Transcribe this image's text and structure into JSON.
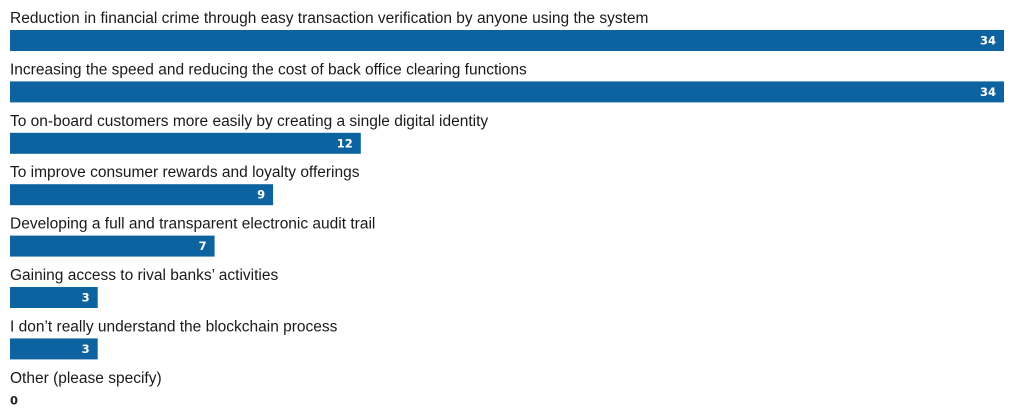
{
  "chart_data": {
    "type": "bar",
    "orientation": "horizontal",
    "categories": [
      "Reduction in financial crime through easy transaction verification by anyone using the system",
      "Increasing the speed and reducing the cost of back office clearing functions",
      "To on-board customers more easily by creating a single digital identity",
      "To improve consumer rewards and loyalty offerings",
      "Developing a full and transparent electronic audit trail",
      "Gaining access to rival banks’ activities",
      "I don’t really understand the blockchain process",
      "Other (please specify)"
    ],
    "values": [
      34,
      34,
      12,
      9,
      7,
      3,
      3,
      0
    ],
    "value_labels": [
      "34",
      "34",
      "12",
      "9",
      "7",
      "3",
      "3",
      "0"
    ],
    "xlim": [
      0,
      34
    ],
    "grid": false,
    "legend": "none",
    "title": "",
    "xlabel": "",
    "ylabel": "",
    "colors": {
      "bar": "#0d63a0",
      "bar_label": "#ffffff",
      "zero_label": "#222222",
      "category_label": "#1a1a1a"
    }
  }
}
